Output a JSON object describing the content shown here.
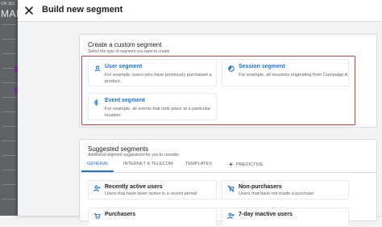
{
  "background_app": {
    "small_text": "ON JEJ",
    "large_text": "MAIN"
  },
  "header": {
    "close_icon": "close-icon",
    "title": "Build new segment"
  },
  "custom_segment": {
    "heading": "Create a custom segment",
    "subheading": "Select the type of segment you want to create",
    "highlight_color": "#e53935",
    "options": [
      {
        "icon": "person-icon",
        "title": "User segment",
        "description": "For example, users who have previously purchased a product."
      },
      {
        "icon": "session-icon",
        "title": "Session segment",
        "description": "For example, all sessions originating from Campaign A."
      },
      {
        "icon": "event-icon",
        "title": "Event segment",
        "description": "For example, all events that took place at a particular location."
      }
    ]
  },
  "suggested_segments": {
    "heading": "Suggested segments",
    "subheading": "Additional segment suggestions for you to consider",
    "tabs": [
      {
        "label": "GENERAL",
        "active": true
      },
      {
        "label": "INTERNET & TELECOM",
        "active": false
      },
      {
        "label": "TEMPLATES",
        "active": false
      },
      {
        "label": "PREDICTIVE",
        "active": false
      }
    ],
    "items": [
      {
        "icon": "person-check-icon",
        "title": "Recently active users",
        "description": "Users that have been active in a recent period"
      },
      {
        "icon": "no-purchase-icon",
        "title": "Non-purchasers",
        "description": "Users that have not made a purchase"
      },
      {
        "icon": "purchase-icon",
        "title": "Purchasers",
        "description": ""
      },
      {
        "icon": "inactive-user-icon",
        "title": "7-day inactive users",
        "description": ""
      }
    ]
  },
  "colors": {
    "accent": "#1a73e8",
    "highlight": "#e53935",
    "background": "#f1f3f4"
  }
}
